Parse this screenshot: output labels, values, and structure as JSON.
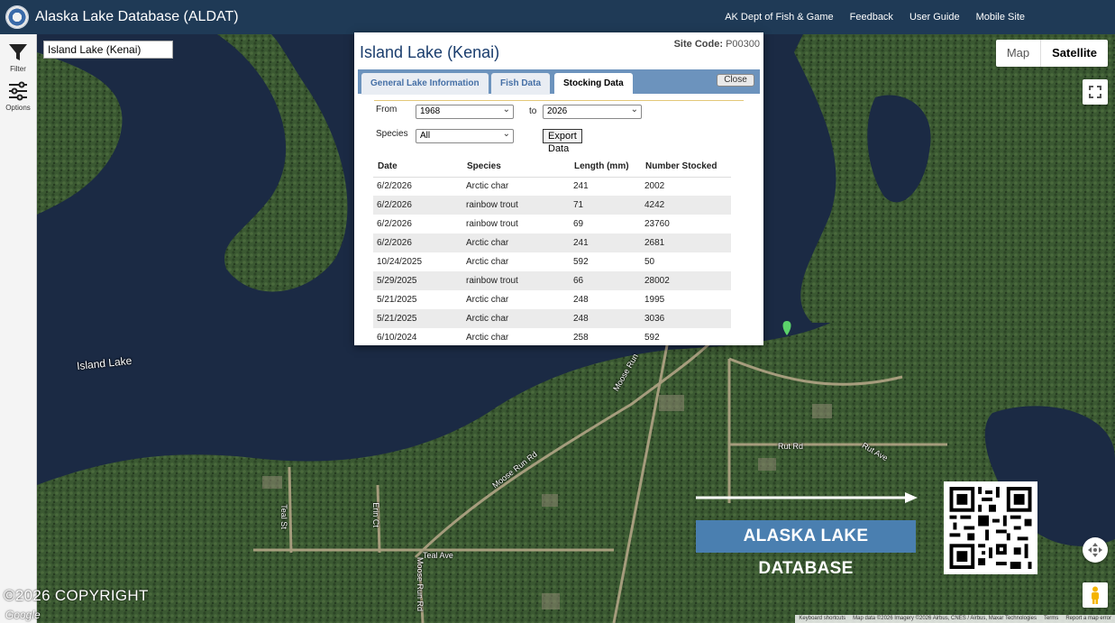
{
  "header": {
    "title": "Alaska Lake Database (ALDAT)",
    "links": [
      "AK Dept of Fish & Game",
      "Feedback",
      "User Guide",
      "Mobile Site"
    ]
  },
  "sidebar": {
    "filter_label": "Filter",
    "options_label": "Options"
  },
  "search": {
    "value": "Island Lake (Kenai)"
  },
  "map": {
    "type_options": [
      "Map",
      "Satellite"
    ],
    "selected_type": "Satellite",
    "labels": {
      "island_lake": "Island Lake",
      "moose_run_rd_1": "Moose Run Rd",
      "moose_run_rd_2": "Moose Run",
      "moose_run_rd_3": "Moose Run Rd",
      "rut_rd": "Rut Rd",
      "rut_ave": "Rut Ave",
      "teal_ave": "Teal Ave",
      "teal_st": "Teal St",
      "erin_ct": "Erin Ct"
    },
    "copyright": "©2026 COPYRIGHT",
    "google": "Google",
    "attribution": [
      "Keyboard shortcuts",
      "Map data ©2026 Imagery ©2026 Airbus, CNES / Airbus, Maxar Technologies",
      "Terms",
      "Report a map error"
    ],
    "banner": "ALASKA LAKE DATABASE"
  },
  "dialog": {
    "title": "Island Lake (Kenai)",
    "site_code_label": "Site Code:",
    "site_code": "P00300",
    "tabs": [
      "General Lake Information",
      "Fish Data",
      "Stocking Data"
    ],
    "active_tab": "Stocking Data",
    "close_label": "Close",
    "filters": {
      "from_label": "From",
      "from_value": "1968",
      "to_label": "to",
      "to_value": "2026",
      "species_label": "Species",
      "species_value": "All",
      "export_label": "Export Data"
    },
    "table": {
      "headers": [
        "Date",
        "Species",
        "Length (mm)",
        "Number Stocked"
      ],
      "rows": [
        [
          "6/2/2026",
          "Arctic char",
          "241",
          "2002"
        ],
        [
          "6/2/2026",
          "rainbow trout",
          "71",
          "4242"
        ],
        [
          "6/2/2026",
          "rainbow trout",
          "69",
          "23760"
        ],
        [
          "6/2/2026",
          "Arctic char",
          "241",
          "2681"
        ],
        [
          "10/24/2025",
          "Arctic char",
          "592",
          "50"
        ],
        [
          "5/29/2025",
          "rainbow trout",
          "66",
          "28002"
        ],
        [
          "5/21/2025",
          "Arctic char",
          "248",
          "1995"
        ],
        [
          "5/21/2025",
          "Arctic char",
          "248",
          "3036"
        ],
        [
          "6/10/2024",
          "Arctic char",
          "258",
          "592"
        ]
      ]
    }
  },
  "colors": {
    "header_bg": "#1f3a56",
    "tab_bar": "#6c93bd",
    "banner_bg": "#4a7fb0",
    "water": "#1a2a44",
    "forest": "#3c5a34"
  }
}
